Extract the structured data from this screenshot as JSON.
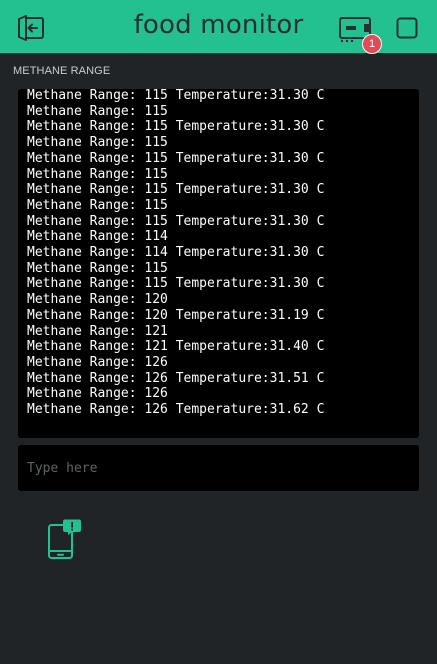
{
  "app": {
    "title": "food monitor",
    "notification_count": "1"
  },
  "widget": {
    "label": "METHANE RANGE"
  },
  "terminal": {
    "lines": [
      "Methane Range: 115 Temperature:31.30 C",
      "Methane Range: 115",
      "Methane Range: 115 Temperature:31.30 C",
      "Methane Range: 115",
      "Methane Range: 115 Temperature:31.30 C",
      "Methane Range: 115",
      "Methane Range: 115 Temperature:31.30 C",
      "Methane Range: 115",
      "Methane Range: 115 Temperature:31.30 C",
      "Methane Range: 114",
      "Methane Range: 114 Temperature:31.30 C",
      "Methane Range: 115",
      "Methane Range: 115 Temperature:31.30 C",
      "Methane Range: 120",
      "Methane Range: 120 Temperature:31.19 C",
      "Methane Range: 121",
      "Methane Range: 121 Temperature:31.40 C",
      "Methane Range: 126",
      "Methane Range: 126 Temperature:31.51 C",
      "Methane Range: 126",
      "Methane Range: 126 Temperature:31.62 C"
    ],
    "input_placeholder": "Type here",
    "input_value": ""
  },
  "icons": {
    "exit": "exit-icon",
    "device": "device-icon",
    "square": "square-icon",
    "phone_alert": "phone-alert-icon"
  },
  "colors": {
    "header": "#23c18f",
    "background": "#212427",
    "terminal": "#000000",
    "badge": "#e24a55",
    "accent": "#23c18f"
  }
}
